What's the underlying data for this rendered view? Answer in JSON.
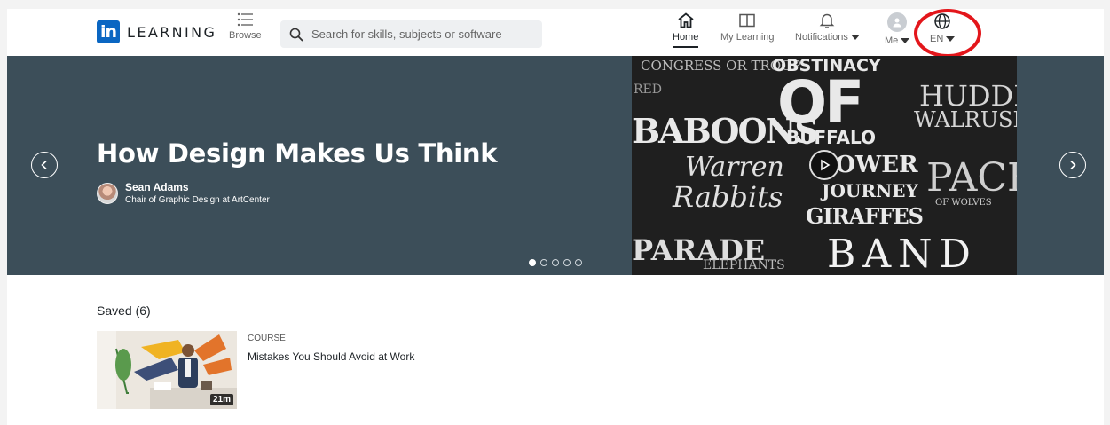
{
  "header": {
    "logo_mark": "in",
    "logo_text": "LEARNING",
    "browse_label": "Browse",
    "search_placeholder": "Search for skills, subjects or software",
    "nav": {
      "home": "Home",
      "my_learning": "My Learning",
      "notifications": "Notifications",
      "me": "Me",
      "language": "EN"
    }
  },
  "hero": {
    "title": "How Design Makes Us Think",
    "author_name": "Sean Adams",
    "author_role": "Chair of Graphic Design at ArtCenter",
    "slide_count": 5,
    "active_slide": 1,
    "art_words": [
      "OBSTINACY",
      "OF",
      "HUDDLE",
      "WALRUSES",
      "BABOONS",
      "BUFFALO",
      "Warren",
      "Rabbits",
      "TOWER",
      "JOURNEY",
      "GIRAFFES",
      "PACK",
      "PARADE",
      "BAND",
      "CONGRESS OR TROOP",
      "OF WOLVES",
      "RED",
      "ELEPHANTS"
    ]
  },
  "saved": {
    "title": "Saved (6)",
    "items": [
      {
        "type": "COURSE",
        "title": "Mistakes You Should Avoid at Work",
        "duration": "21m"
      }
    ]
  },
  "colors": {
    "brand": "#0a66c2",
    "hero_bg": "#3c4e59",
    "annotation": "#e3161b"
  },
  "icons": [
    "linkedin-logo-icon",
    "list-icon",
    "search-icon",
    "home-icon",
    "book-icon",
    "bell-icon",
    "avatar-icon",
    "globe-icon",
    "chevron-left-icon",
    "chevron-right-icon",
    "play-icon"
  ]
}
